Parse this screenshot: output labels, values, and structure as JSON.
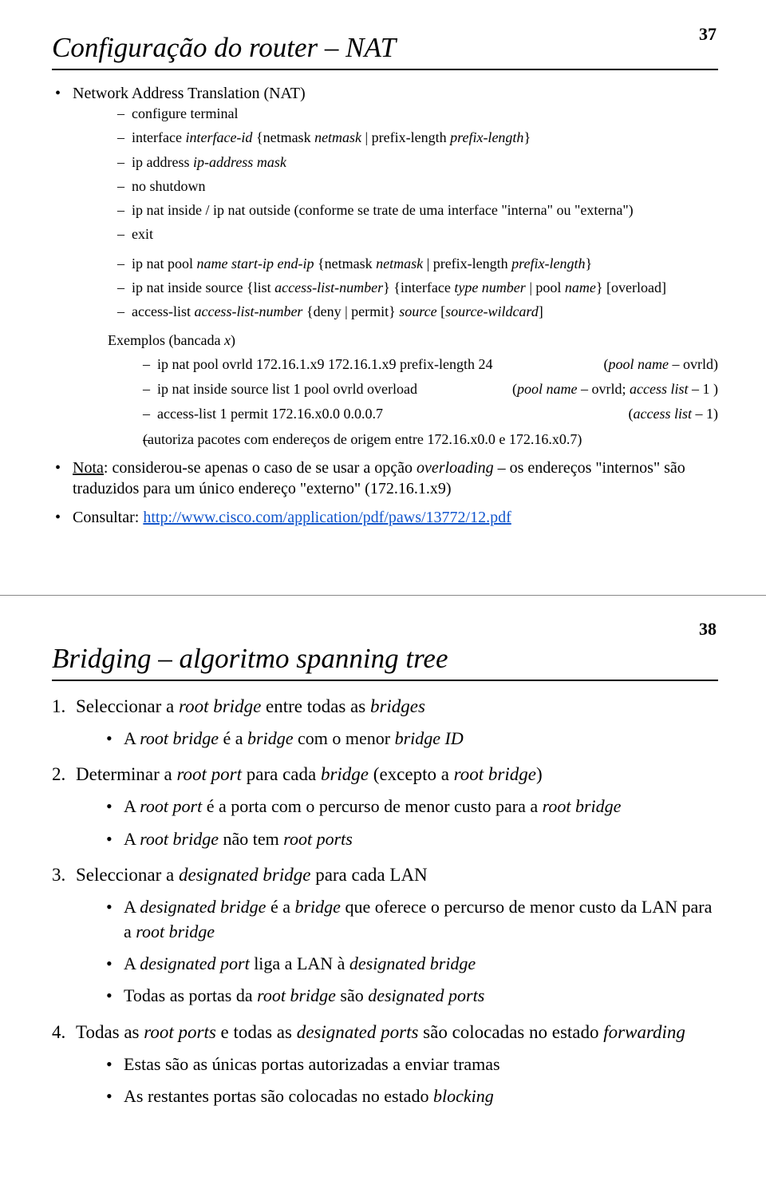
{
  "slide1": {
    "page": "37",
    "title": "Configuração do router – NAT",
    "heading1": "Network Address Translation (NAT)",
    "block1": {
      "l1": "configure terminal",
      "l2a": "interface ",
      "l2b": "interface-id",
      "l2c": " {netmask ",
      "l2d": "netmask",
      "l2e": " | prefix-length ",
      "l2f": "prefix-length",
      "l2g": "}",
      "l3a": "ip address ",
      "l3b": "ip-address  mask",
      "l4": "no shutdown",
      "l5": "ip nat inside / ip nat outside (conforme se trate de uma interface \"interna\" ou \"externa\")",
      "l6": "exit",
      "l7a": "ip nat pool ",
      "l7b": "name start-ip end-ip",
      "l7c": " {netmask ",
      "l7d": "netmask",
      "l7e": " | prefix-length ",
      "l7f": "prefix-length",
      "l7g": "}",
      "l8a": "ip nat inside source {list ",
      "l8b": "access-list-number",
      "l8c": "} {interface ",
      "l8d": "type number",
      "l8e": " | pool ",
      "l8f": "name",
      "l8g": "} [overload]",
      "l9a": "access-list ",
      "l9b": "access-list-number",
      "l9c": " {deny | permit} ",
      "l9d": "source",
      "l9e": " [",
      "l9f": "source-wildcard",
      "l9g": "]"
    },
    "exemplos_label_a": "Exemplos (bancada ",
    "exemplos_label_b": "x",
    "exemplos_label_c": ")",
    "ex": {
      "r1l": "ip nat pool ovrld 172.16.1.x9 172.16.1.x9 prefix-length 24",
      "r1r_a": "(",
      "r1r_b": "pool name",
      "r1r_c": " – ovrld)",
      "r2l": "ip nat inside source list 1 pool ovrld overload",
      "r2r_a": "(",
      "r2r_b": "pool name",
      "r2r_c": " – ovrld; ",
      "r2r_d": "access list",
      "r2r_e": " – 1 )",
      "r3l": "access-list 1 permit 172.16.x0.0 0.0.0.7",
      "r3r_a": "(",
      "r3r_b": "access list",
      "r3r_c": " – 1)",
      "r4": "(autoriza pacotes com endereços de origem entre 172.16.x0.0 e 172.16.x0.7)"
    },
    "nota_a": "Nota",
    "nota_b": ": considerou-se apenas o caso de se usar a opção ",
    "nota_c": "overloading",
    "nota_d": " – os endereços \"internos\" são traduzidos para um único endereço \"externo\" (172.16.1.x9)",
    "consultar_label": "Consultar: ",
    "consultar_url": "http://www.cisco.com/application/pdf/paws/13772/12.pdf"
  },
  "slide2": {
    "page": "38",
    "title": "Bridging – algoritmo spanning tree",
    "o1": {
      "num": "1.",
      "t1": "Seleccionar a ",
      "i1": "root bridge",
      "t2": " entre todas as ",
      "i2": "bridges",
      "b1_a": "A ",
      "b1_b": "root bridge",
      "b1_c": " é a ",
      "b1_d": "bridge",
      "b1_e": " com o menor ",
      "b1_f": "bridge ID"
    },
    "o2": {
      "num": "2.",
      "t1": "Determinar a ",
      "i1": "root port",
      "t2": " para cada ",
      "i2": "bridge",
      "t3": " (excepto a ",
      "i3": "root bridge",
      "t4": ")",
      "b1_a": "A ",
      "b1_b": "root port",
      "b1_c": " é a porta com o percurso de menor custo para a ",
      "b1_d": "root bridge",
      "b2_a": "A ",
      "b2_b": "root bridge",
      "b2_c": " não tem ",
      "b2_d": "root ports"
    },
    "o3": {
      "num": "3.",
      "t1": "Seleccionar a ",
      "i1": "designated bridge",
      "t2": " para cada LAN",
      "b1_a": "A ",
      "b1_b": "designated bridge",
      "b1_c": " é a ",
      "b1_d": "bridge",
      "b1_e": " que oferece o percurso de menor custo da LAN para a ",
      "b1_f": "root bridge",
      "b2_a": "A ",
      "b2_b": "designated port",
      "b2_c": " liga a LAN à ",
      "b2_d": "designated bridge",
      "b3_a": "Todas as portas da ",
      "b3_b": "root bridge",
      "b3_c": " são ",
      "b3_d": "designated ports"
    },
    "o4": {
      "num": "4.",
      "t1": "Todas as ",
      "i1": "root ports",
      "t2": " e todas as ",
      "i2": "designated ports",
      "t3": " são colocadas no estado ",
      "i3": "forwarding",
      "b1": "Estas são as únicas portas autorizadas a enviar tramas",
      "b2_a": "As restantes portas são colocadas no estado ",
      "b2_b": "blocking"
    }
  }
}
